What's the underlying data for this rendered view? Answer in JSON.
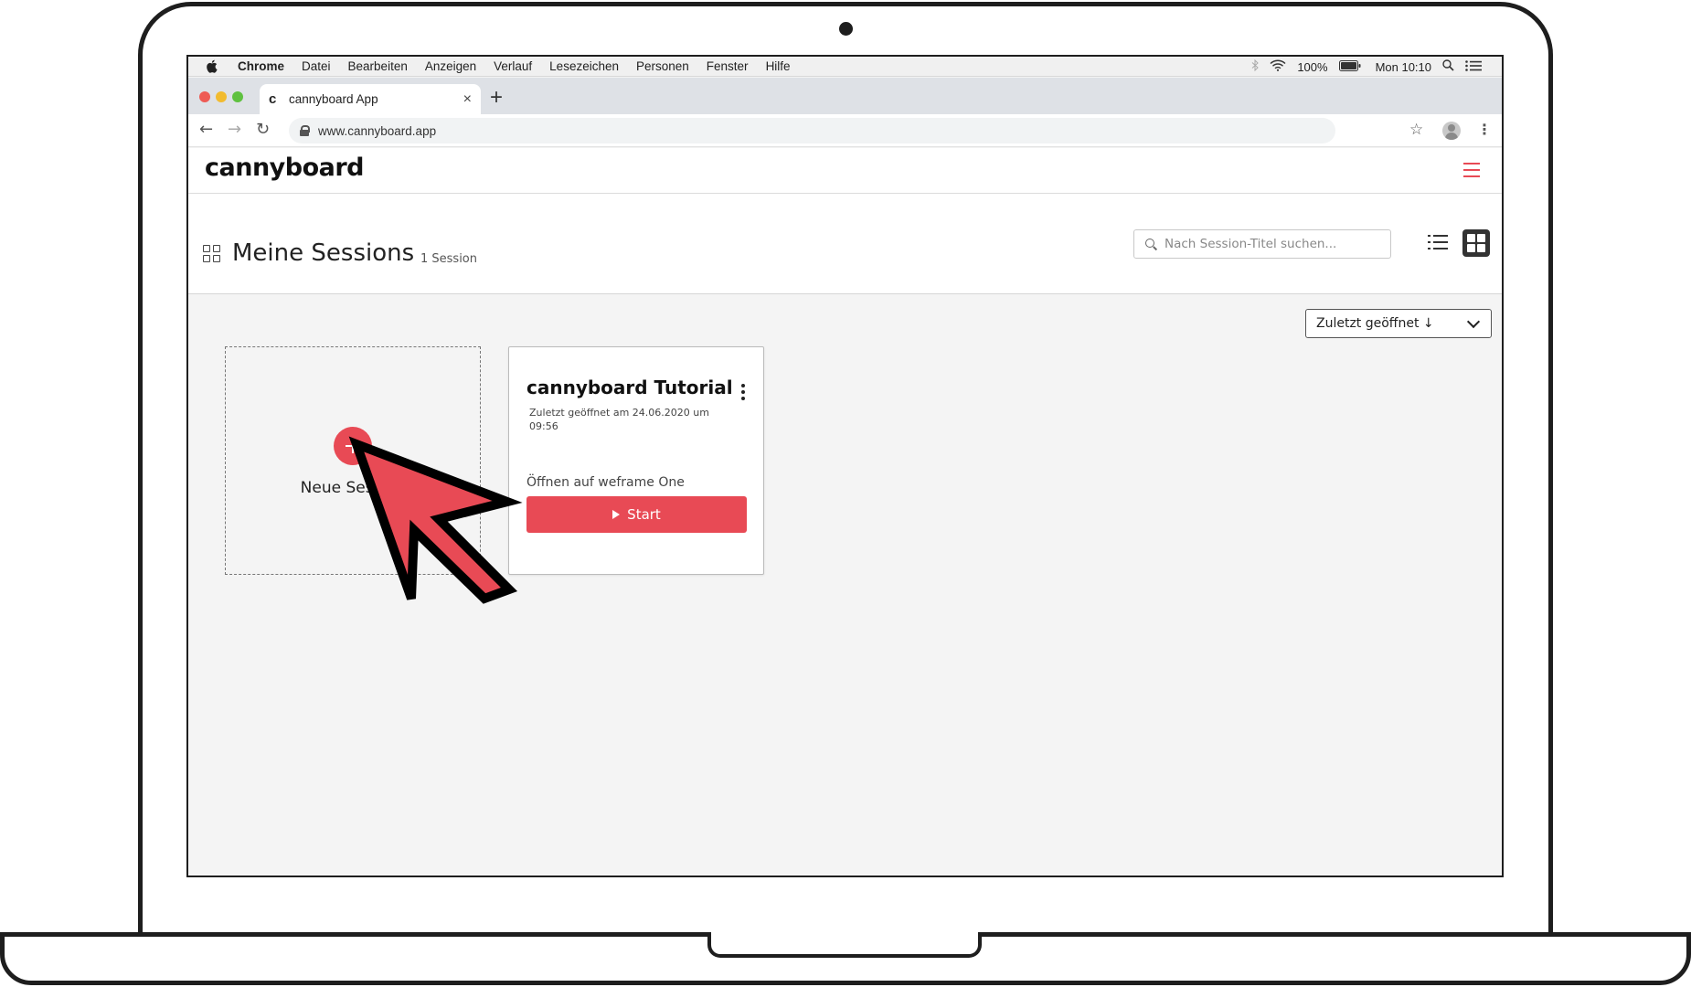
{
  "menubar": {
    "items": [
      "Chrome",
      "Datei",
      "Bearbeiten",
      "Anzeigen",
      "Verlauf",
      "Lesezeichen",
      "Personen",
      "Fenster",
      "Hilfe"
    ],
    "battery": "100%",
    "clock": "Mon 10:10"
  },
  "browser": {
    "tab_title": "cannyboard App",
    "tab_favicon": "c",
    "url": "www.cannyboard.app"
  },
  "app": {
    "logo": "cannyboard"
  },
  "sessions": {
    "title": "Meine Sessions",
    "count": "1 Session",
    "search_placeholder": "Nach Session-Titel suchen...",
    "sort_label": "Zuletzt geöffnet ↓",
    "new_session_label": "Neue Session",
    "card": {
      "title": "cannyboard Tutorial",
      "meta": "Zuletzt geöffnet am 24.06.2020 um 09:56",
      "open_on": "Öffnen auf weframe One",
      "start_label": "Start"
    }
  },
  "colors": {
    "accent": "#e84a55",
    "frame": "#1e1e1e",
    "background": "#f4f4f4"
  },
  "icons": {
    "menubar": [
      "apple-icon",
      "bluetooth-icon",
      "wifi-icon",
      "battery-icon",
      "spotlight-icon",
      "control-center-icon"
    ],
    "toolbar": [
      "back-icon",
      "forward-icon",
      "reload-icon",
      "lock-icon",
      "star-icon",
      "profile-icon",
      "kebab-icon"
    ],
    "app": [
      "hamburger-icon",
      "grid-icon",
      "search-icon",
      "list-view-icon",
      "grid-view-icon",
      "chevron-down-icon",
      "plus-icon",
      "more-icon",
      "play-icon",
      "cursor-arrow-icon"
    ]
  }
}
